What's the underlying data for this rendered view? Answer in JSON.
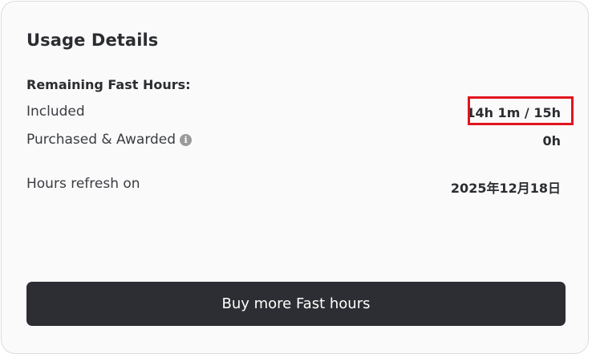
{
  "card": {
    "title": "Usage Details",
    "section_label": "Remaining Fast Hours:",
    "included": {
      "label": "Included",
      "value": "14h 1m / 15h"
    },
    "purchased": {
      "label": "Purchased & Awarded",
      "info_icon": "info-icon",
      "value": "0h"
    },
    "refresh": {
      "label": "Hours refresh on",
      "value": "2025年12月18日"
    },
    "buy_button_label": "Buy more Fast hours"
  },
  "colors": {
    "highlight": "#e0141e",
    "button_bg": "#2d2e33"
  }
}
